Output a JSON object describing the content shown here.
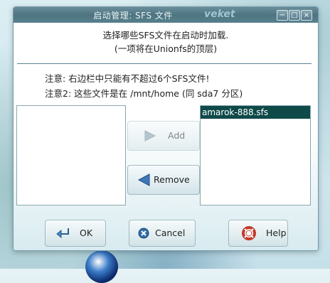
{
  "window": {
    "title": "启动管理: SFS 文件",
    "brand": "veket",
    "controls": {
      "minimize": "−",
      "maximize": "□",
      "close": "×"
    }
  },
  "intro": {
    "line1": "选择哪些SFS文件在启动时加载.",
    "line2": "(一项将在Unionfs的顶层)"
  },
  "notes": {
    "note1": "注意: 右边栏中只能有不超过6个SFS文件!",
    "note2": "注意2: 这些文件是在 /mnt/home (同 sda7 分区)"
  },
  "lists": {
    "available": [],
    "selected": [
      "amarok-888.sfs"
    ]
  },
  "buttons": {
    "add": "Add",
    "remove": "Remove",
    "ok": "OK",
    "cancel": "Cancel",
    "help": "Help"
  },
  "icons": {
    "add": "play-arrow-icon",
    "remove": "back-arrow-icon",
    "ok": "enter-return-icon",
    "cancel": "cancel-x-icon",
    "help": "lifebuoy-icon"
  }
}
